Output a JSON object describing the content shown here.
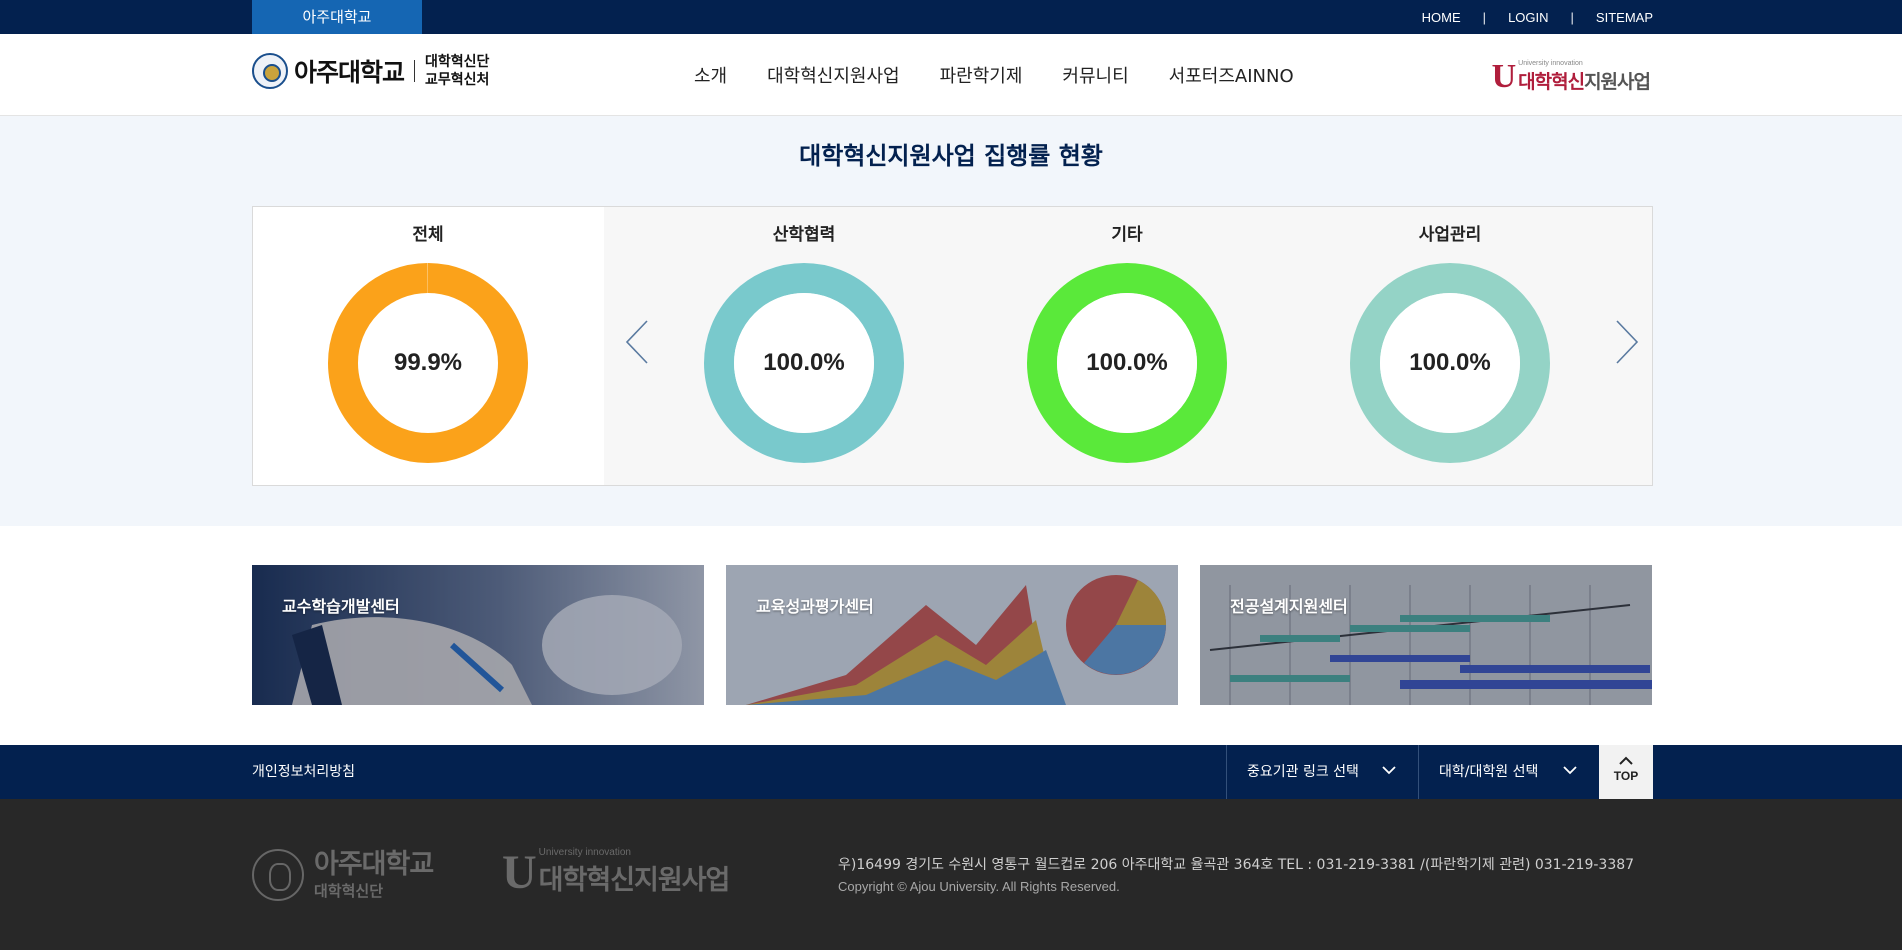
{
  "topbar": {
    "tab": "아주대학교",
    "links": [
      "HOME",
      "LOGIN",
      "SITEMAP"
    ]
  },
  "header": {
    "logo_name": "아주대학교",
    "logo_sub1": "대학혁신단",
    "logo_sub2": "교무혁신처",
    "nav": [
      "소개",
      "대학혁신지원사업",
      "파란학기제",
      "커뮤니티",
      "서포터즈AINNO"
    ],
    "brand_tiny": "University innovation",
    "brand_red": "대학혁신",
    "brand_gray": "지원사업"
  },
  "status": {
    "title": "대학혁신지원사업 집행률 현황",
    "gauges": [
      {
        "label": "전체",
        "value": 99.9,
        "display": "99.9%",
        "color": "#fba21a"
      },
      {
        "label": "산학협력",
        "value": 100.0,
        "display": "100.0%",
        "color": "#79c9cc"
      },
      {
        "label": "기타",
        "value": 100.0,
        "display": "100.0%",
        "color": "#5ae93a"
      },
      {
        "label": "사업관리",
        "value": 100.0,
        "display": "100.0%",
        "color": "#94d3c6"
      }
    ]
  },
  "centers": [
    "교수학습개발센터",
    "교육성과평가센터",
    "전공설계지원센터"
  ],
  "footbar": {
    "privacy": "개인정보처리방침",
    "select1": "중요기관 링크 선택",
    "select2": "대학/대학원 선택",
    "top": "TOP"
  },
  "footer": {
    "logo_name": "아주대학교",
    "logo_sub": "대학혁신단",
    "brand_tiny": "University innovation",
    "brand_big": "대학혁신지원사업",
    "address": "우)16499 경기도 수원시 영통구 월드컵로 206 아주대학교 율곡관 364호   TEL : 031-219-3381 /(파란학기제 관련) 031-219-3387",
    "copyright": "Copyright © Ajou University. All Rights Reserved."
  },
  "colors": {
    "navy": "#03214f",
    "tab_blue": "#1566b3",
    "footer_bg": "#282828"
  }
}
